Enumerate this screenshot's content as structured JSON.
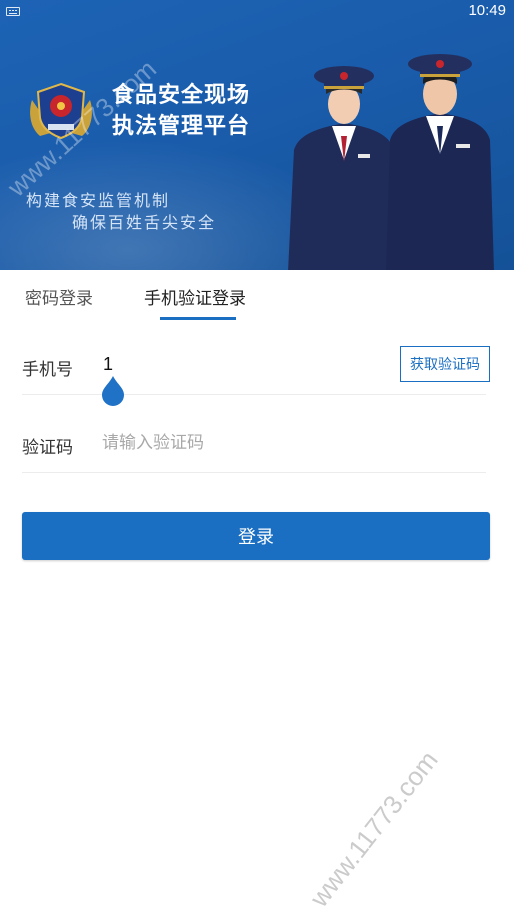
{
  "status_bar": {
    "time": "10:49",
    "keyboard_icon": "keyboard-icon"
  },
  "banner": {
    "headline_line1": "食品安全现场",
    "headline_line2": "执法管理平台",
    "slogan_line1": "构建食安监管机制",
    "slogan_line2": "确保百姓舌尖安全",
    "emblem_icon": "emblem-icon",
    "background_color": "#1a5cab"
  },
  "tabs": [
    {
      "label": "密码登录",
      "selected": false
    },
    {
      "label": "手机验证登录",
      "selected": true
    }
  ],
  "form": {
    "phone_label": "手机号",
    "phone_value": "1",
    "get_code_label": "获取验证码",
    "code_label": "验证码",
    "code_placeholder": "请输入验证码"
  },
  "login_button": {
    "label": "登录",
    "color": "#1b6fc2"
  },
  "watermark": "www.11773.com"
}
